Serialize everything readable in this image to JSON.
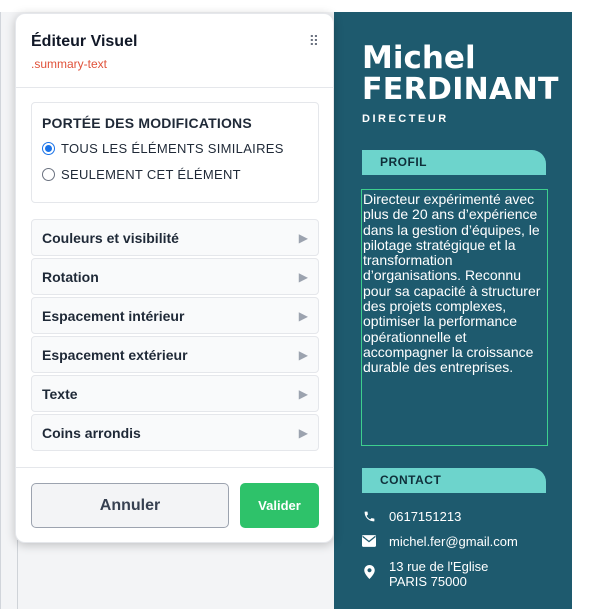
{
  "editor": {
    "title": "Éditeur Visuel",
    "selector": ".summary-text",
    "drag_glyph": "⠿",
    "scope": {
      "title": "PORTÉE DES MODIFICATIONS",
      "options": [
        {
          "label": "TOUS LES ÉLÉMENTS SIMILAIRES",
          "selected": true
        },
        {
          "label": "SEULEMENT CET ÉLÉMENT",
          "selected": false
        }
      ]
    },
    "sections": [
      {
        "label": "Couleurs et visibilité",
        "arrow": "▶"
      },
      {
        "label": "Rotation",
        "arrow": "▶"
      },
      {
        "label": "Espacement intérieur",
        "arrow": "▶"
      },
      {
        "label": "Espacement extérieur",
        "arrow": "▶"
      },
      {
        "label": "Texte",
        "arrow": "▶"
      },
      {
        "label": "Coins arrondis",
        "arrow": "▶"
      }
    ],
    "cancel_label": "Annuler",
    "confirm_label": "Valider"
  },
  "resume": {
    "first_name": "Michel",
    "last_name": "FERDINANT",
    "role": "DIRECTEUR",
    "profile_heading": "PROFIL",
    "summary": "Directeur expérimenté avec plus de 20 ans d’expérience dans la gestion d’équipes, le pilotage stratégique et la transformation d’organisations. Reconnu pour sa capacité à structurer des projets complexes, optimiser la performance opérationnelle et accompagner la croissance durable des entreprises.",
    "contact_heading": "CONTACT",
    "phone": "0617151213",
    "email": "michel.fer@gmail.com",
    "address_line1": "13 rue de l'Eglise",
    "address_line2": "PARIS 75000"
  },
  "icons": [
    "phone-icon",
    "envelope-icon",
    "map-pin-icon",
    "chevron-right-icon",
    "drag-handle-icon"
  ],
  "colors": {
    "resume_bg": "#1e5a6e",
    "section_tab": "#6dd4cc",
    "selector_text": "#e0523a",
    "confirm_button": "#2ec26a",
    "radio_selected": "#1a73e8",
    "selection_outline": "#3ecf8e"
  }
}
